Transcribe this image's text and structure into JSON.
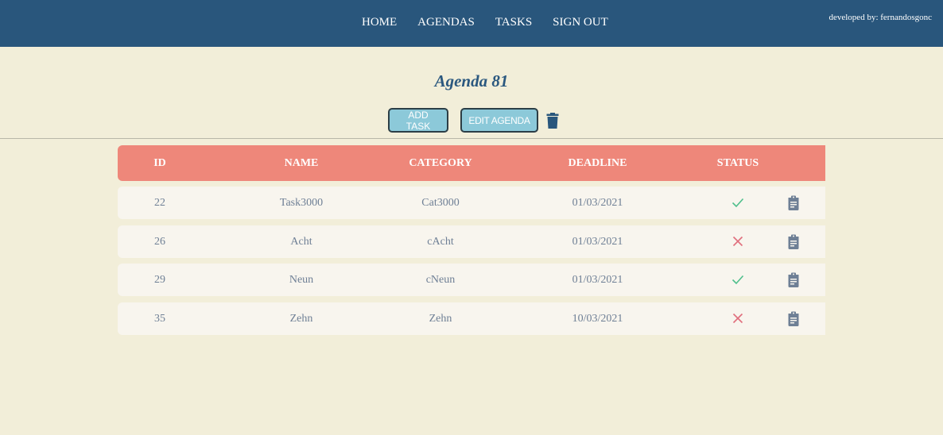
{
  "nav": {
    "items": [
      "HOME",
      "AGENDAS",
      "TASKS",
      "SIGN OUT"
    ],
    "credit": "developed by: fernandosgonc"
  },
  "page": {
    "title": "Agenda 81",
    "add_task_label": "ADD TASK",
    "edit_agenda_label": "EDIT AGENDA",
    "delete_icon": "trash-icon"
  },
  "table": {
    "headers": [
      "ID",
      "NAME",
      "CATEGORY",
      "DEADLINE",
      "STATUS"
    ],
    "rows": [
      {
        "id": "22",
        "name": "Task3000",
        "category": "Cat3000",
        "deadline": "01/03/2021",
        "status": "done"
      },
      {
        "id": "26",
        "name": "Acht",
        "category": "cAcht",
        "deadline": "01/03/2021",
        "status": "not-done"
      },
      {
        "id": "29",
        "name": "Neun",
        "category": "cNeun",
        "deadline": "01/03/2021",
        "status": "done"
      },
      {
        "id": "35",
        "name": "Zehn",
        "category": "Zehn",
        "deadline": "10/03/2021",
        "status": "not-done"
      }
    ]
  },
  "colors": {
    "navbar": "#29567c",
    "background": "#f2eed9",
    "header": "#ee877a",
    "button": "#8cc9d9",
    "done": "#4fbf8c",
    "not_done": "#e06f7d"
  }
}
